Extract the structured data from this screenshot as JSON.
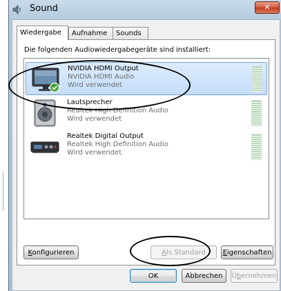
{
  "window": {
    "title": "Sound",
    "close_glyph": "✕"
  },
  "tabs": [
    {
      "label": "Wiedergabe"
    },
    {
      "label": "Aufnahme"
    },
    {
      "label": "Sounds"
    }
  ],
  "panel": {
    "label": "Die folgenden Audiowiedergabegeräte sind installiert:"
  },
  "devices": [
    {
      "name": "NVIDIA HDMI Output",
      "description": "NVIDIA HDMI Audio",
      "status": "Wird verwendet",
      "icon": "monitor-icon",
      "selected": true,
      "default_check": true
    },
    {
      "name": "Lautsprecher",
      "description": "Realtek High Definition Audio",
      "status": "Wird verwendet",
      "icon": "speaker-icon",
      "selected": false
    },
    {
      "name": "Realtek Digital Output",
      "description": "Realtek High Definition Audio",
      "status": "Wird verwendet",
      "icon": "digital-output-icon",
      "selected": false
    }
  ],
  "buttons": {
    "configure": {
      "hot": "K",
      "rest": "onfigurieren"
    },
    "set_default": {
      "hot": "A",
      "rest": "ls Standard",
      "disabled": true
    },
    "properties": {
      "hot": "E",
      "rest": "igenschaften"
    },
    "ok": {
      "label": "OK"
    },
    "cancel": {
      "label": "Abbrechen"
    },
    "apply": {
      "pre": "Ü",
      "hot": "b",
      "rest": "ernehmen",
      "disabled": true
    }
  },
  "colors": {
    "selection": "#c4ddf8",
    "close_button": "#c94a2d",
    "title_bg": "#b9cfe2"
  }
}
